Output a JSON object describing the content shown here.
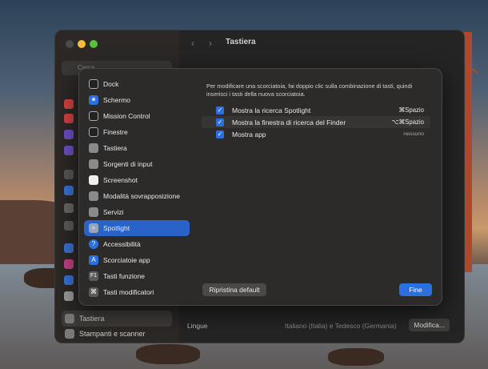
{
  "window": {
    "title": "Tastiera"
  },
  "sidebar": {
    "search_placeholder": "Cerca",
    "items": [
      {
        "label": "Tastiera"
      },
      {
        "label": "Stampanti e scanner"
      }
    ]
  },
  "main": {
    "rows": [
      {
        "label": "Lingue",
        "value": "Italiano (Italia) e Tedesco (Germania)",
        "button": "Modifica..."
      }
    ]
  },
  "dialog": {
    "categories": [
      {
        "label": "Dock",
        "icon": "dock-icon"
      },
      {
        "label": "Schermo",
        "icon": "display-icon"
      },
      {
        "label": "Mission Control",
        "icon": "mission-control-icon"
      },
      {
        "label": "Finestre",
        "icon": "windows-icon"
      },
      {
        "label": "Tastiera",
        "icon": "keyboard-icon"
      },
      {
        "label": "Sorgenti di input",
        "icon": "input-sources-icon"
      },
      {
        "label": "Screenshot",
        "icon": "screenshot-icon"
      },
      {
        "label": "Modalità sovrapposizione",
        "icon": "overlay-icon"
      },
      {
        "label": "Servizi",
        "icon": "services-icon"
      },
      {
        "label": "Spotlight",
        "icon": "spotlight-icon"
      },
      {
        "label": "Accessibilità",
        "icon": "accessibility-icon"
      },
      {
        "label": "Scorciatoie app",
        "icon": "app-shortcuts-icon"
      },
      {
        "label": "Tasti funzione",
        "icon": "function-keys-icon"
      },
      {
        "label": "Tasti modificatori",
        "icon": "modifier-keys-icon"
      }
    ],
    "selected": "Spotlight",
    "description": "Per modificare una scorciatoia, fai doppio clic sulla combinazione di tasti, quindi inserisci i tasti della nuova scorciatoia.",
    "shortcuts": [
      {
        "label": "Mostra la ricerca Spotlight",
        "key": "⌘Spazio",
        "checked": true
      },
      {
        "label": "Mostra la finestra di ricerca del Finder",
        "key": "⌥⌘Spazio",
        "checked": true
      },
      {
        "label": "Mostra app",
        "key": "nessuno",
        "checked": true
      }
    ],
    "reset_label": "Ripristina default",
    "done_label": "Fine"
  },
  "colors": {
    "accent": "#2a70e0",
    "selected": "#2a63c7"
  }
}
